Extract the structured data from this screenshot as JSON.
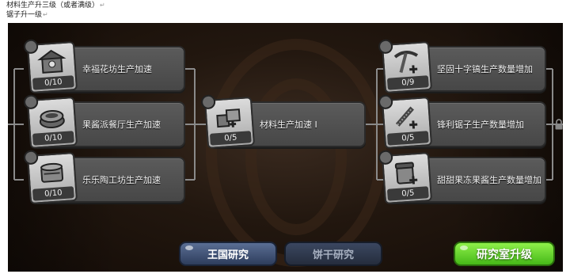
{
  "notes": {
    "line1": "材料生产升三级（或者满级）",
    "line2": "锯子升一级",
    "mark": "↵"
  },
  "left_nodes": [
    {
      "label": "幸福花坊生产加速",
      "count": "0/10",
      "icon": "flower-shop-icon"
    },
    {
      "label": "果酱派餐厅生产加速",
      "count": "0/10",
      "icon": "jam-pie-icon"
    },
    {
      "label": "乐乐陶工坊生产加速",
      "count": "0/10",
      "icon": "pottery-icon"
    }
  ],
  "center_node": {
    "label": "材料生产加速 I",
    "count": "0/5",
    "icon": "materials-icon"
  },
  "right_nodes": [
    {
      "label": "坚固十字镐生产数量增加",
      "count": "0/9",
      "icon": "pickaxe-icon"
    },
    {
      "label": "锋利锯子生产数量增加",
      "count": "0/5",
      "icon": "saw-icon"
    },
    {
      "label": "甜甜果冻果酱生产数量增加",
      "count": "0/5",
      "icon": "jelly-jam-icon"
    }
  ],
  "bottom_bar": {
    "tab_kingdom": "王国研究",
    "tab_cookie": "饼干研究",
    "upgrade": "研究室升级"
  },
  "colors": {
    "card": "#515151",
    "upgrade_green": "#5fd02a",
    "tab_active": "#42557a"
  }
}
